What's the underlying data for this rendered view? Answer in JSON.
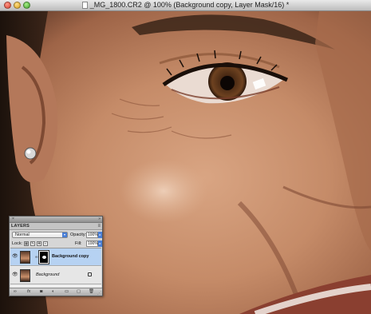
{
  "window": {
    "title": "_MG_1800.CR2 @ 100% (Background copy, Layer Mask/16) *"
  },
  "layers_panel": {
    "tab_label": "LAYERS",
    "blend_mode": "Normal",
    "opacity_label": "Opacity:",
    "opacity_value": "100%",
    "lock_label": "Lock:",
    "fill_label": "Fill:",
    "fill_value": "100%",
    "layers": [
      {
        "name": "Background copy",
        "selected": true,
        "has_mask": true
      },
      {
        "name": "Background",
        "selected": false,
        "locked": true
      }
    ],
    "bottom_icons": [
      "link-layers-icon",
      "fx-icon",
      "add-mask-icon",
      "adjustment-layer-icon",
      "new-group-icon",
      "new-layer-icon",
      "trash-icon"
    ]
  },
  "colors": {
    "selected_row": "#b6d2f2",
    "accent_blue": "#4a7fd6"
  }
}
